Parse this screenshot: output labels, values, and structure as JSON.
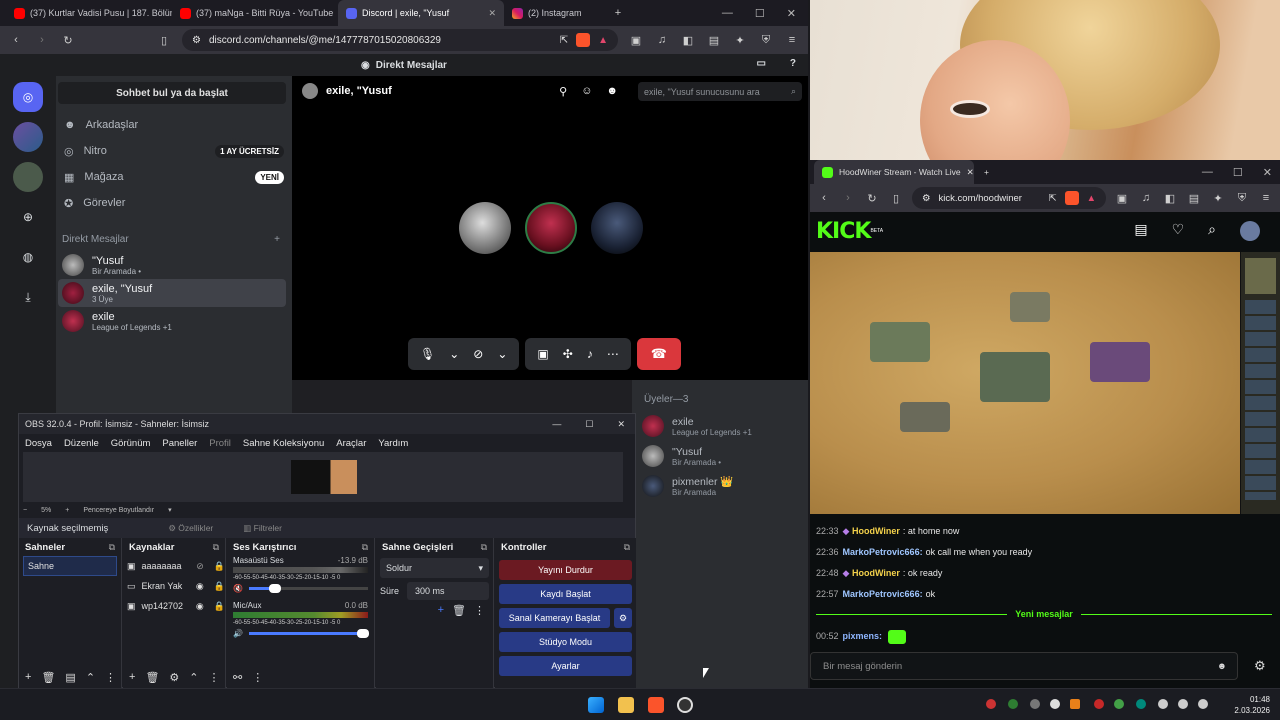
{
  "browser1": {
    "tabs": [
      {
        "label": "(37) Kurtlar Vadisi Pusu | 187. Bölüm",
        "icon": "youtube-icon"
      },
      {
        "label": "(37) maNga - Bitti Rüya - YouTube",
        "icon": "youtube-icon"
      },
      {
        "label": "Discord | exile, \"Yusuf",
        "icon": "discord-icon"
      },
      {
        "label": "(2) Instagram",
        "icon": "instagram-icon"
      }
    ],
    "url": "discord.com/channels/@me/1477787015020806329"
  },
  "discord": {
    "top_title": "Direkt Mesajlar",
    "search_button": "Sohbet bul ya da başlat",
    "nav": [
      {
        "label": "Arkadaşlar",
        "icon": "friends-icon"
      },
      {
        "label": "Nitro",
        "icon": "nitro-icon",
        "badge": "1 AY ÜCRETSİZ"
      },
      {
        "label": "Mağaza",
        "icon": "shop-icon",
        "badge": "YENİ"
      },
      {
        "label": "Görevler",
        "icon": "quests-icon"
      }
    ],
    "dm_header": "Direkt Mesajlar",
    "dm_add": "+",
    "dms": [
      {
        "name": "\"Yusuf",
        "sub": "Bir Aramada •"
      },
      {
        "name": "exile, \"Yusuf",
        "sub": "3 Üye"
      },
      {
        "name": "exile",
        "sub": "League of Legends +1"
      }
    ],
    "call": {
      "title": "exile, \"Yusuf",
      "search_placeholder": "exile, \"Yusuf sunucusunu ara"
    },
    "members_header": "Üyeler—3",
    "members": [
      {
        "name": "exile",
        "sub": "League of Legends +1"
      },
      {
        "name": "\"Yusuf",
        "sub": "Bir Aramada •"
      },
      {
        "name": "pixmenler 👑",
        "sub": "Bir Aramada"
      }
    ]
  },
  "obs": {
    "title": "OBS 32.0.4 - Profil: İsimsiz - Sahneler: İsimsiz",
    "menu": [
      "Dosya",
      "Düzenle",
      "Görünüm",
      "Paneller",
      "Profil",
      "Sahne Koleksiyonu",
      "Araçlar",
      "Yardım"
    ],
    "zoom": "5%",
    "fit_label": "Pencereye Boyutlandır",
    "no_source": "Kaynak seçilmemiş",
    "properties": "Özellikler",
    "filters": "Filtreler",
    "docks": {
      "scenes": "Sahneler",
      "sources": "Kaynaklar",
      "mixer": "Ses Karıştırıcı",
      "transitions": "Sahne Geçişleri",
      "controls": "Kontroller"
    },
    "scene_items": [
      "Sahne"
    ],
    "source_items": [
      "aaaaaaaa",
      "Ekran Yak",
      "wp142702"
    ],
    "mixer": [
      {
        "name": "Masaüstü Ses",
        "db": "-13.9 dB",
        "level": 0.22
      },
      {
        "name": "Mic/Aux",
        "db": "0.0 dB",
        "level": 0.96
      }
    ],
    "meter_scale": "-60-55-50-45-40-35-30-25-20-15-10 -5 0",
    "transition": "Soldur",
    "duration_label": "Süre",
    "duration": "300 ms",
    "controls": [
      "Yayını Durdur",
      "Kaydı Başlat",
      "Sanal Kamerayı Başlat",
      "Stüdyo Modu",
      "Ayarlar"
    ]
  },
  "browser2": {
    "tab": "HoodWiner Stream - Watch Live",
    "url": "kick.com/hoodwiner",
    "logo": "KICK",
    "logo_sup": "BETA",
    "chat": [
      {
        "time": "22:33",
        "user": "HoodWiner",
        "msg": "at home now",
        "color": "#f3d14b"
      },
      {
        "time": "22:36",
        "user": "MarkoPetrovic666:",
        "msg": "ok call me when you ready",
        "color": "#9fc6ff"
      },
      {
        "time": "22:48",
        "user": "HoodWiner",
        "msg": "ok ready",
        "color": "#f3d14b"
      },
      {
        "time": "22:57",
        "user": "MarkoPetrovic666:",
        "msg": "ok",
        "color": "#9fc6ff"
      }
    ],
    "new_messages": "Yeni mesajlar",
    "last_chat": {
      "time": "00:52",
      "user": "pixmens:",
      "color": "#8fb6ff"
    },
    "chat_placeholder": "Bir mesaj gönderin"
  },
  "taskbar": {
    "time": "01:48",
    "date": "2.03.2026"
  }
}
